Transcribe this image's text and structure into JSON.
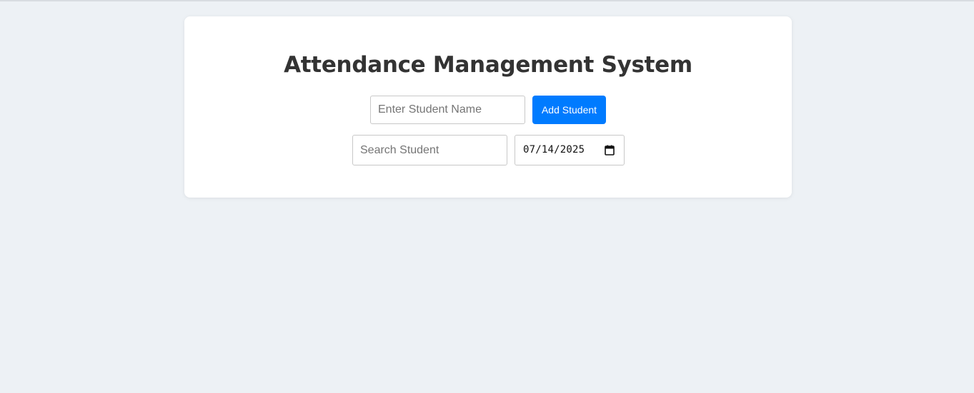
{
  "app": {
    "title": "Attendance Management System"
  },
  "add_form": {
    "name_placeholder": "Enter Student Name",
    "name_value": "",
    "add_button_label": "Add Student"
  },
  "filter_form": {
    "search_placeholder": "Search Student",
    "search_value": "",
    "date_value": "07/14/2025"
  },
  "icons": {
    "date_picker": "calendar-icon"
  },
  "colors": {
    "accent": "#007bff",
    "background": "#edf1f5",
    "card": "#ffffff",
    "title_text": "#333333"
  }
}
